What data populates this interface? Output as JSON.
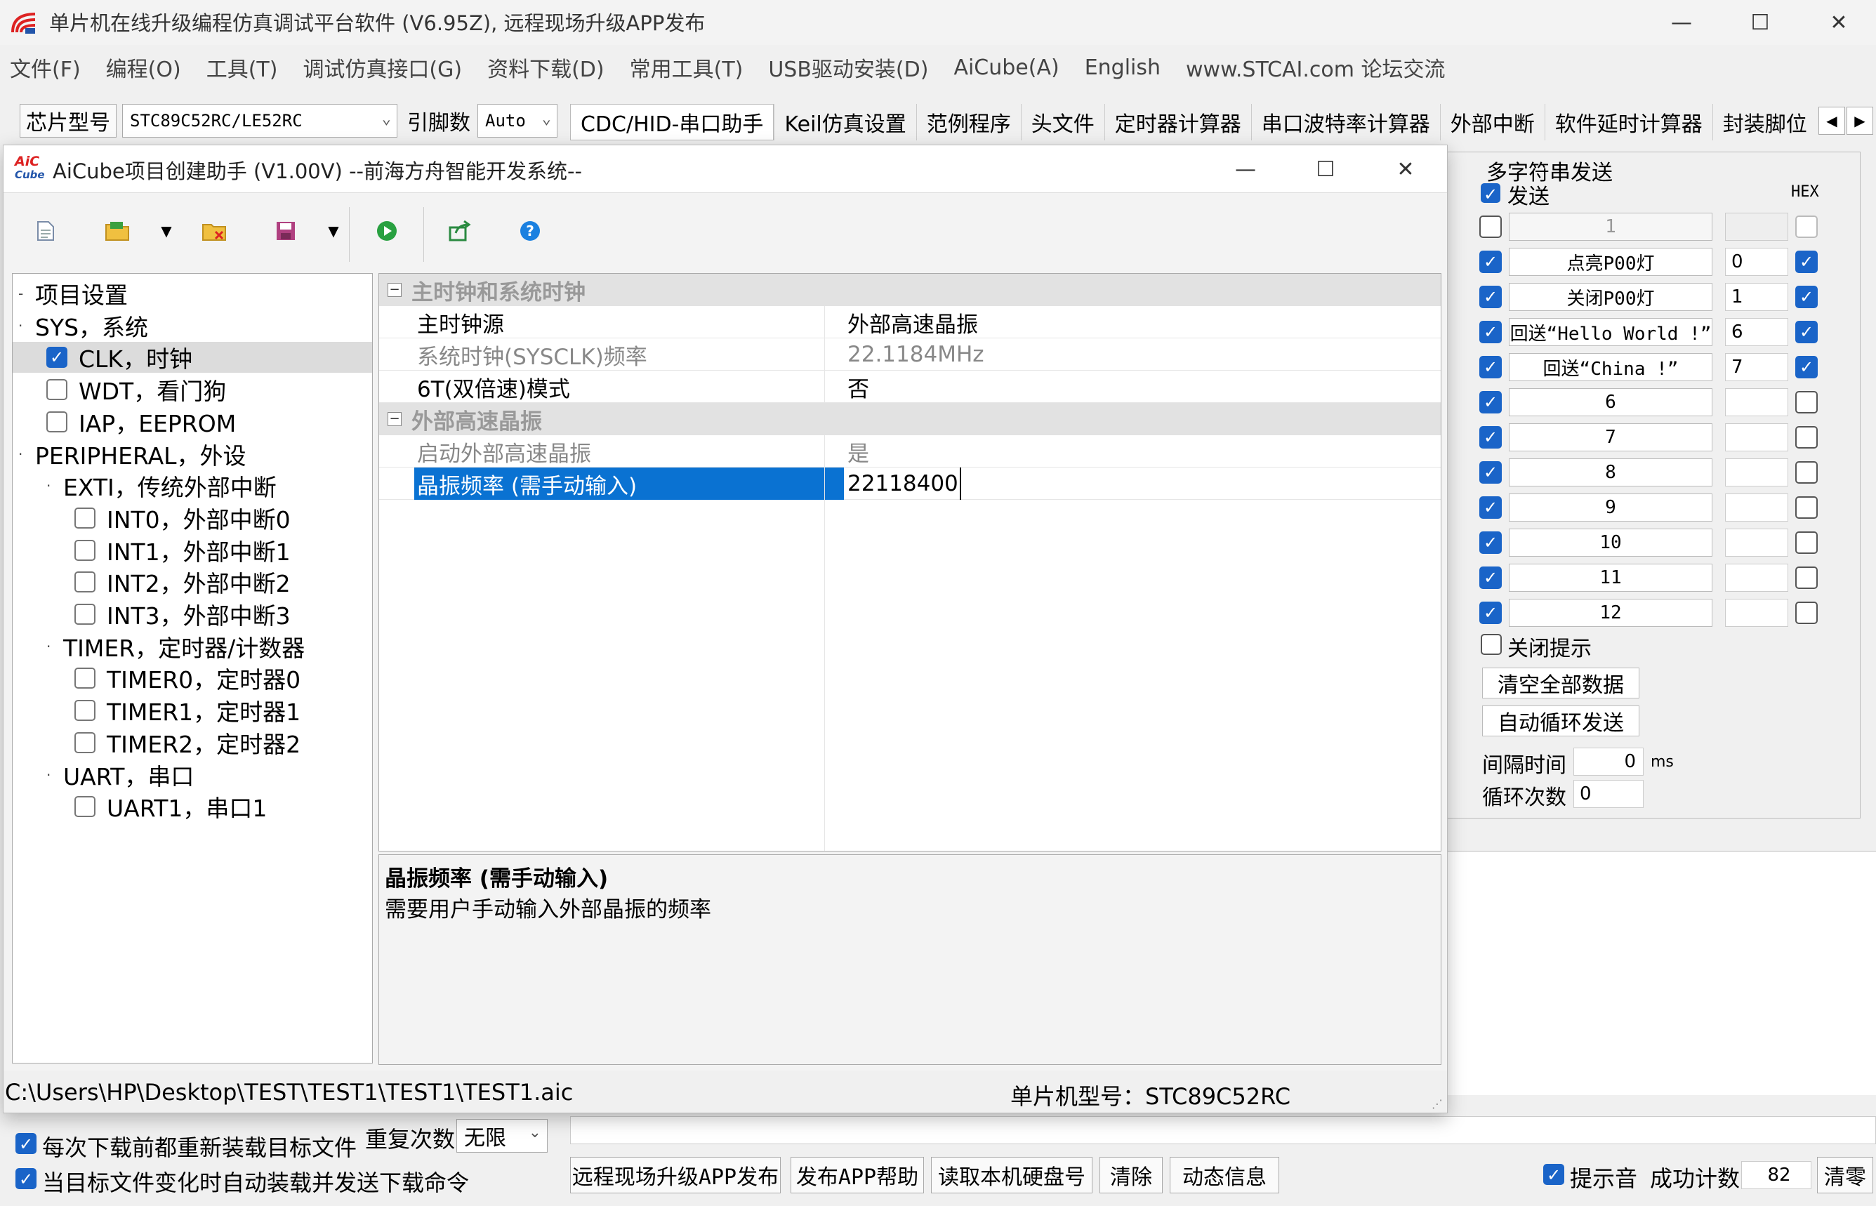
{
  "main": {
    "title": "单片机在线升级编程仿真调试平台软件 (V6.95Z), 远程现场升级APP发布",
    "menu": [
      "文件(F)",
      "编程(O)",
      "工具(T)",
      "调试仿真接口(G)",
      "资料下载(D)",
      "常用工具(T)",
      "USB驱动安装(D)",
      "AiCube(A)",
      "English",
      "www.STCAI.com 论坛交流"
    ],
    "toolbar": {
      "chip_label": "芯片型号",
      "chip_value": "STC89C52RC/LE52RC",
      "pins_label": "引脚数",
      "pins_value": "Auto",
      "tabs": [
        "CDC/HID-串口助手",
        "Keil仿真设置",
        "范例程序",
        "头文件",
        "定时器计算器",
        "串口波特率计算器",
        "外部中断",
        "软件延时计算器",
        "封装脚位"
      ]
    },
    "multi": {
      "title": "多字符串发送",
      "send_label": "发送",
      "hex_label": "HEX",
      "rows": [
        {
          "checked": false,
          "label": "1",
          "value": "",
          "hex": false,
          "disabled": true
        },
        {
          "checked": true,
          "label": "点亮P00灯",
          "value": "0",
          "hex": true
        },
        {
          "checked": true,
          "label": "关闭P00灯",
          "value": "1",
          "hex": true
        },
        {
          "checked": true,
          "label": "回送“Hello World !”",
          "value": "6",
          "hex": true
        },
        {
          "checked": true,
          "label": "回送“China !”",
          "value": "7",
          "hex": true
        },
        {
          "checked": true,
          "label": "6",
          "value": "",
          "hex": false
        },
        {
          "checked": true,
          "label": "7",
          "value": "",
          "hex": false
        },
        {
          "checked": true,
          "label": "8",
          "value": "",
          "hex": false
        },
        {
          "checked": true,
          "label": "9",
          "value": "",
          "hex": false
        },
        {
          "checked": true,
          "label": "10",
          "value": "",
          "hex": false
        },
        {
          "checked": true,
          "label": "11",
          "value": "",
          "hex": false
        },
        {
          "checked": true,
          "label": "12",
          "value": "",
          "hex": false
        }
      ],
      "close_tip": "关闭提示",
      "clear_all": "清空全部数据",
      "auto_loop": "自动循环发送",
      "interval_label": "间隔时间",
      "interval_value": "0",
      "interval_unit": "ms",
      "loop_label": "循环次数",
      "loop_value": "0"
    },
    "bottom": {
      "reload_label": "每次下载前都重新装载目标文件",
      "auto_label": "当目标文件变化时自动装载并发送下载命令",
      "repeat_label": "重复次数",
      "repeat_value": "无限",
      "buttons": [
        "远程现场升级APP发布",
        "发布APP帮助",
        "读取本机硬盘号",
        "清除",
        "动态信息"
      ],
      "sound_label": "提示音",
      "success_label": "成功计数",
      "success_value": "82",
      "clear_count": "清零"
    }
  },
  "dialog": {
    "title": "AiCube项目创建助手 (V1.00V) --前海方舟智能开发系统--",
    "tree": [
      {
        "label": "项目设置",
        "level": 0,
        "cb": null
      },
      {
        "label": "SYS，系统",
        "level": 0,
        "cb": null,
        "dot": true
      },
      {
        "label": "CLK，时钟",
        "level": 1,
        "cb": true,
        "selected": true
      },
      {
        "label": "WDT，看门狗",
        "level": 1,
        "cb": false
      },
      {
        "label": "IAP，EEPROM",
        "level": 1,
        "cb": false
      },
      {
        "label": "PERIPHERAL，外设",
        "level": 0,
        "cb": null,
        "dot": true
      },
      {
        "label": "EXTI，传统外部中断",
        "level": 1,
        "cb": null,
        "dot": true
      },
      {
        "label": "INT0，外部中断0",
        "level": 2,
        "cb": false
      },
      {
        "label": "INT1，外部中断1",
        "level": 2,
        "cb": false
      },
      {
        "label": "INT2，外部中断2",
        "level": 2,
        "cb": false
      },
      {
        "label": "INT3，外部中断3",
        "level": 2,
        "cb": false
      },
      {
        "label": "TIMER，定时器/计数器",
        "level": 1,
        "cb": null,
        "dot": true
      },
      {
        "label": "TIMER0，定时器0",
        "level": 2,
        "cb": false
      },
      {
        "label": "TIMER1，定时器1",
        "level": 2,
        "cb": false
      },
      {
        "label": "TIMER2，定时器2",
        "level": 2,
        "cb": false
      },
      {
        "label": "UART，串口",
        "level": 1,
        "cb": null,
        "dot": true
      },
      {
        "label": "UART1，串口1",
        "level": 2,
        "cb": false
      }
    ],
    "grid": {
      "cat1": "主时钟和系统时钟",
      "rows1": [
        {
          "key": "主时钟源",
          "value": "外部高速晶振",
          "grey": false
        },
        {
          "key": "系统时钟(SYSCLK)频率",
          "value": "22.1184MHz",
          "grey": true
        },
        {
          "key": "6T(双倍速)模式",
          "value": "否",
          "grey": false
        }
      ],
      "cat2": "外部高速晶振",
      "rows2": [
        {
          "key": "启动外部高速晶振",
          "value": "是",
          "grey": true
        },
        {
          "key": "晶振频率 (需手动输入)",
          "value": "22118400",
          "grey": false,
          "selected": true
        }
      ]
    },
    "desc": {
      "title": "晶振频率 (需手动输入)",
      "text": "需要用户手动输入外部晶振的频率"
    },
    "status": {
      "path": "C:\\Users\\HP\\Desktop\\TEST\\TEST1\\TEST1\\TEST1.aic",
      "chip": "单片机型号：STC89C52RC"
    }
  }
}
